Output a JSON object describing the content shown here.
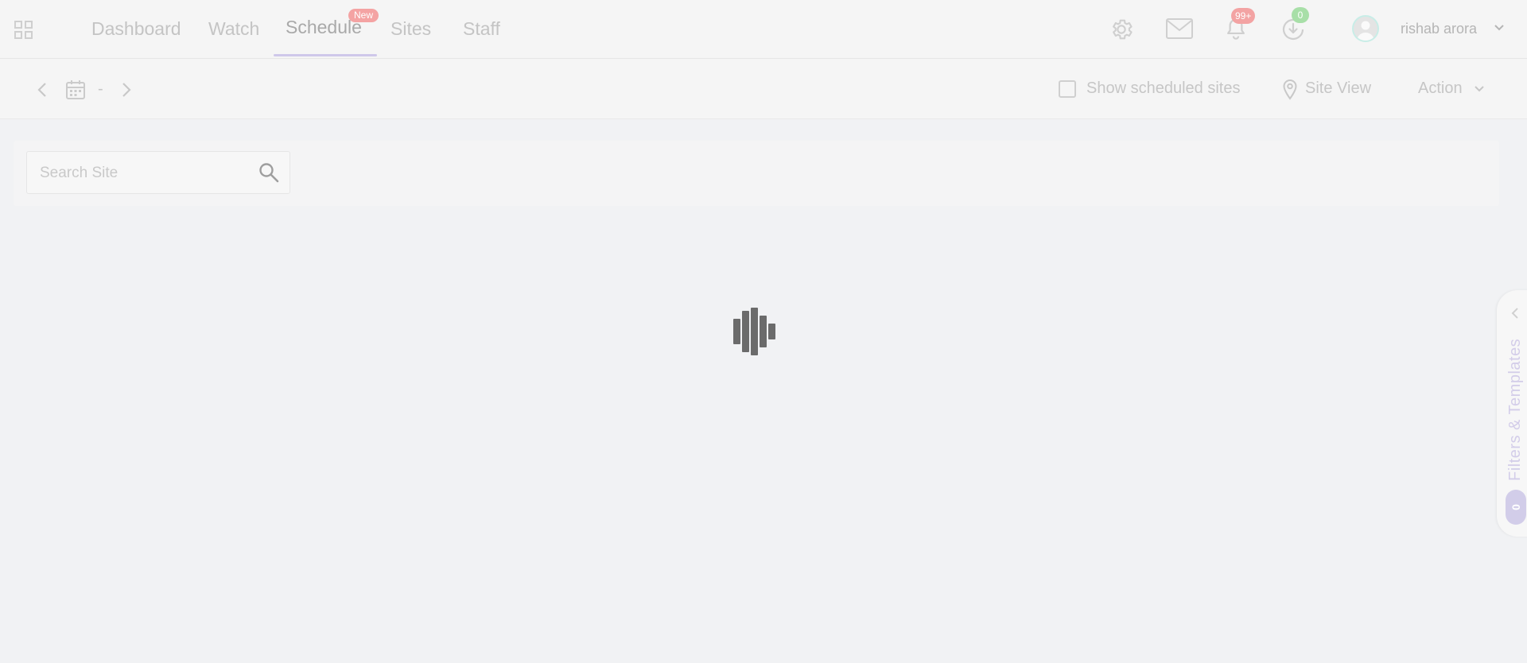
{
  "nav": {
    "tabs": [
      {
        "label": "Dashboard"
      },
      {
        "label": "Watch"
      },
      {
        "label": "Schedule",
        "badge": "New",
        "active": true
      },
      {
        "label": "Sites"
      },
      {
        "label": "Staff"
      }
    ],
    "notifications_badge": "99+",
    "downloads_badge": "0",
    "user_name": "rishab arora",
    "icons": [
      "apps-grid-icon",
      "gear-icon",
      "mail-icon",
      "bell-icon",
      "download-clock-icon",
      "avatar",
      "chevron-down-icon"
    ]
  },
  "toolbar": {
    "date_range": "-",
    "show_scheduled_label": "Show scheduled sites",
    "show_scheduled_checked": false,
    "site_view_label": "Site View",
    "action_label": "Action"
  },
  "search": {
    "placeholder": "Search Site",
    "value": ""
  },
  "drawer": {
    "label": "Filters & Templates",
    "count": "0"
  },
  "colors": {
    "background": "#f1f2f4",
    "accent": "#cfc8ea",
    "badge_red": "#f4a3a3",
    "badge_green": "#a8dfa8",
    "loader": "#6b6b6b"
  }
}
